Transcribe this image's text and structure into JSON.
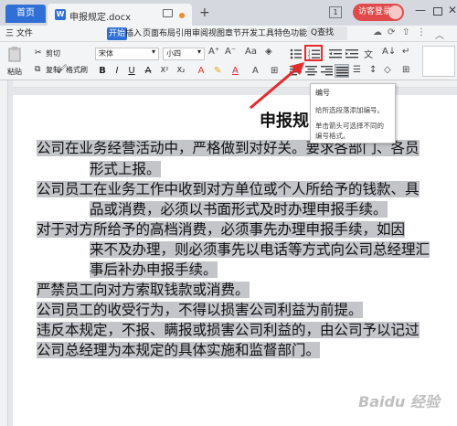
{
  "titlebar": {
    "home_tab": "首页",
    "doc_tab": "申报规定.docx",
    "doc_icon": "W",
    "plus": "+",
    "page_count": "1",
    "login": "访客登录",
    "minimize": "—",
    "close": "✕"
  },
  "menu": {
    "file": "三 文件",
    "items": [
      "开始",
      "插入",
      "页面布局",
      "引用",
      "审阅",
      "视图",
      "章节",
      "开发工具",
      "特色功能"
    ],
    "search": "Q查找"
  },
  "ribbon": {
    "paste": "粘贴",
    "cut": "剪切",
    "copy": "复制",
    "format_painter": "格式刷",
    "font_name": "宋体",
    "font_size": "小四",
    "bold": "B",
    "italic": "I",
    "underline": "U",
    "strike": "A",
    "sup": "X²",
    "sub": "X₂",
    "font_color": "A",
    "grow": "A⁺",
    "shrink": "A⁻"
  },
  "tooltip": {
    "title": "编号",
    "line1": "给所选段落添加编号。",
    "line2": "单击箭头可选择不同的",
    "line3": "编号格式。"
  },
  "document": {
    "heading": "申报规",
    "lines": [
      "公司在业务经营活动中，严格做到对好关。要求各部门、各员",
      "形式上报。",
      "公司员工在业务工作中收到对方单位或个人所给予的钱款、具",
      "品或消费，必须以书面形式及时办理申报手续。",
      "对于对方所给予的高档消费，必须事先办理申报手续，如因",
      "来不及办理，则必须事先以电话等方式向公司总经理汇",
      "事后补办申报手续。",
      "严禁员工向对方索取钱款或消费。",
      "公司员工的收受行为，不得以损害公司利益为前提。",
      "违反本规定，不报、瞒报或损害公司利益的，由公司予以记过",
      "公司总经理为本规定的具体实施和监督部门。"
    ]
  },
  "watermark": "Baidu 经验",
  "colors": {
    "accent": "#2f6fd6",
    "login": "#e04a4a",
    "highlight_box": "#e52b2b",
    "selection": "#c3c5c9"
  }
}
